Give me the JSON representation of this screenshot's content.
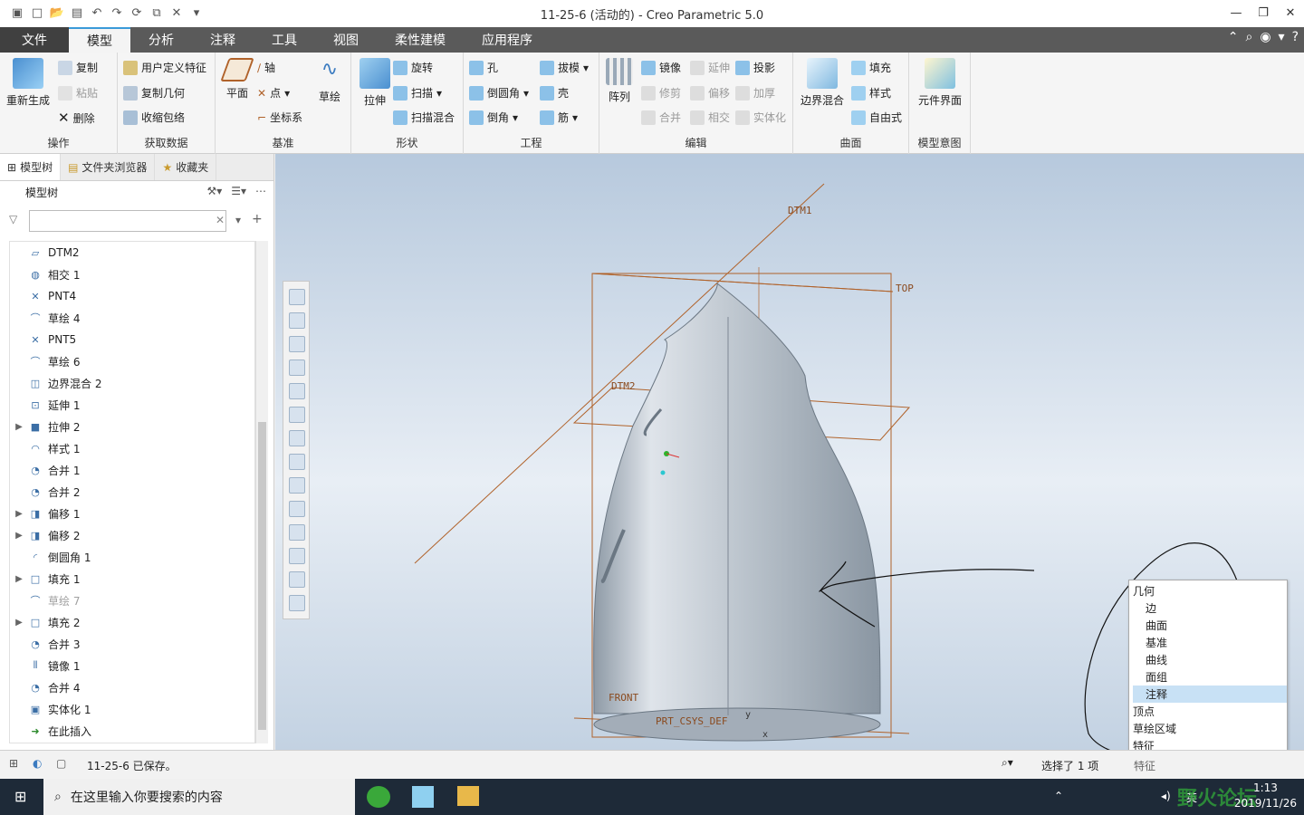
{
  "window": {
    "title": "11-25-6 (活动的) - Creo Parametric 5.0"
  },
  "tabs": [
    {
      "label": "文件"
    },
    {
      "label": "模型"
    },
    {
      "label": "分析"
    },
    {
      "label": "注释"
    },
    {
      "label": "工具"
    },
    {
      "label": "视图"
    },
    {
      "label": "柔性建模"
    },
    {
      "label": "应用程序"
    }
  ],
  "ribbon": {
    "ops": {
      "label": "操作",
      "regen": "重新生成",
      "copy": "复制",
      "paste": "粘贴",
      "delete": "删除"
    },
    "getdata": {
      "label": "获取数据",
      "udf": "用户定义特征",
      "copygeom": "复制几何",
      "shrinkwrap": "收缩包络"
    },
    "datum": {
      "label": "基准",
      "plane": "平面",
      "axis": "轴",
      "point": "点",
      "csys": "坐标系",
      "sketch": "草绘"
    },
    "shapes": {
      "label": "形状",
      "extrude": "拉伸",
      "revolve": "旋转",
      "sweep": "扫描",
      "sweptblend": "扫描混合"
    },
    "engineering": {
      "label": "工程",
      "hole": "孔",
      "round": "倒圆角",
      "chamfer": "倒角",
      "draft": "拔模",
      "shell": "壳",
      "rib": "筋"
    },
    "editing": {
      "label": "编辑",
      "pattern": "阵列",
      "mirror": "镜像",
      "extend": "延伸",
      "project": "投影",
      "trim": "修剪",
      "offset": "偏移",
      "thicken": "加厚",
      "merge": "合并",
      "intersect": "相交",
      "solidify": "实体化"
    },
    "surfaces": {
      "label": "曲面",
      "boundary": "边界混合",
      "fill": "填充",
      "style": "样式",
      "freestyle": "自由式"
    },
    "modelintent": {
      "label": "模型意图",
      "component": "元件界面"
    }
  },
  "leftpanel": {
    "tabs": [
      "模型树",
      "文件夹浏览器",
      "收藏夹"
    ],
    "header": "模型树",
    "filter_placeholder": "",
    "tree": [
      {
        "label": "DTM2",
        "icon": "plane-icon",
        "exp": false,
        "grey": false
      },
      {
        "label": "相交 1",
        "icon": "intersect-icon",
        "exp": false,
        "grey": false
      },
      {
        "label": "PNT4",
        "icon": "point-icon",
        "exp": false,
        "grey": false
      },
      {
        "label": "草绘 4",
        "icon": "sketch-icon",
        "exp": false,
        "grey": false
      },
      {
        "label": "PNT5",
        "icon": "point-icon",
        "exp": false,
        "grey": false
      },
      {
        "label": "草绘 6",
        "icon": "sketch-icon",
        "exp": false,
        "grey": false
      },
      {
        "label": "边界混合 2",
        "icon": "boundary-icon",
        "exp": false,
        "grey": false
      },
      {
        "label": "延伸 1",
        "icon": "extend-icon",
        "exp": false,
        "grey": false
      },
      {
        "label": "拉伸 2",
        "icon": "extrude-icon",
        "exp": true,
        "grey": false
      },
      {
        "label": "样式 1",
        "icon": "style-icon",
        "exp": false,
        "grey": false
      },
      {
        "label": "合并 1",
        "icon": "merge-icon",
        "exp": false,
        "grey": false
      },
      {
        "label": "合并 2",
        "icon": "merge-icon",
        "exp": false,
        "grey": false
      },
      {
        "label": "偏移 1",
        "icon": "offset-icon",
        "exp": true,
        "grey": false
      },
      {
        "label": "偏移 2",
        "icon": "offset-icon",
        "exp": true,
        "grey": false
      },
      {
        "label": "倒圆角 1",
        "icon": "round-icon",
        "exp": false,
        "grey": false
      },
      {
        "label": "填充 1",
        "icon": "fill-icon",
        "exp": true,
        "grey": false
      },
      {
        "label": "草绘 7",
        "icon": "sketch-icon",
        "exp": false,
        "grey": true
      },
      {
        "label": "填充 2",
        "icon": "fill-icon",
        "exp": true,
        "grey": false
      },
      {
        "label": "合并 3",
        "icon": "merge-icon",
        "exp": false,
        "grey": false
      },
      {
        "label": "镜像 1",
        "icon": "mirror-icon",
        "exp": false,
        "grey": false
      },
      {
        "label": "合并 4",
        "icon": "merge-icon",
        "exp": false,
        "grey": false
      },
      {
        "label": "实体化 1",
        "icon": "solidify-icon",
        "exp": false,
        "grey": false
      },
      {
        "label": "在此插入",
        "icon": "insert-arrow-icon",
        "exp": false,
        "grey": false
      }
    ]
  },
  "viewport": {
    "labels": {
      "dtm1": "DTM1",
      "dtm2": "DTM2",
      "top": "TOP",
      "front": "FRONT",
      "csys": "PRT_CSYS_DEF",
      "x": "x",
      "y": "y"
    }
  },
  "popup": {
    "items": [
      {
        "label": "几何",
        "sub": false,
        "hl": false
      },
      {
        "label": "边",
        "sub": true,
        "hl": false
      },
      {
        "label": "曲面",
        "sub": true,
        "hl": false
      },
      {
        "label": "基准",
        "sub": true,
        "hl": false
      },
      {
        "label": "曲线",
        "sub": true,
        "hl": false
      },
      {
        "label": "面组",
        "sub": true,
        "hl": false
      },
      {
        "label": "注释",
        "sub": true,
        "hl": true
      },
      {
        "label": "顶点",
        "sub": false,
        "hl": false
      },
      {
        "label": "草绘区域",
        "sub": false,
        "hl": false
      },
      {
        "label": "特征",
        "sub": false,
        "hl": false
      }
    ]
  },
  "status": {
    "message": "11-25-6 已保存。",
    "selection": "选择了 1 项",
    "filter_value": "特征"
  },
  "taskbar": {
    "search_placeholder": "在这里输入你要搜索的内容",
    "time": "1:13",
    "date": "2019/11/26",
    "ime": "英",
    "watermark": "野火论坛"
  },
  "colors": {
    "tab_bar": "#5a5a5a",
    "accent": "#3a9ad9",
    "datum_orange": "#b0622a",
    "selection_highlight": "#c8e1f5"
  }
}
